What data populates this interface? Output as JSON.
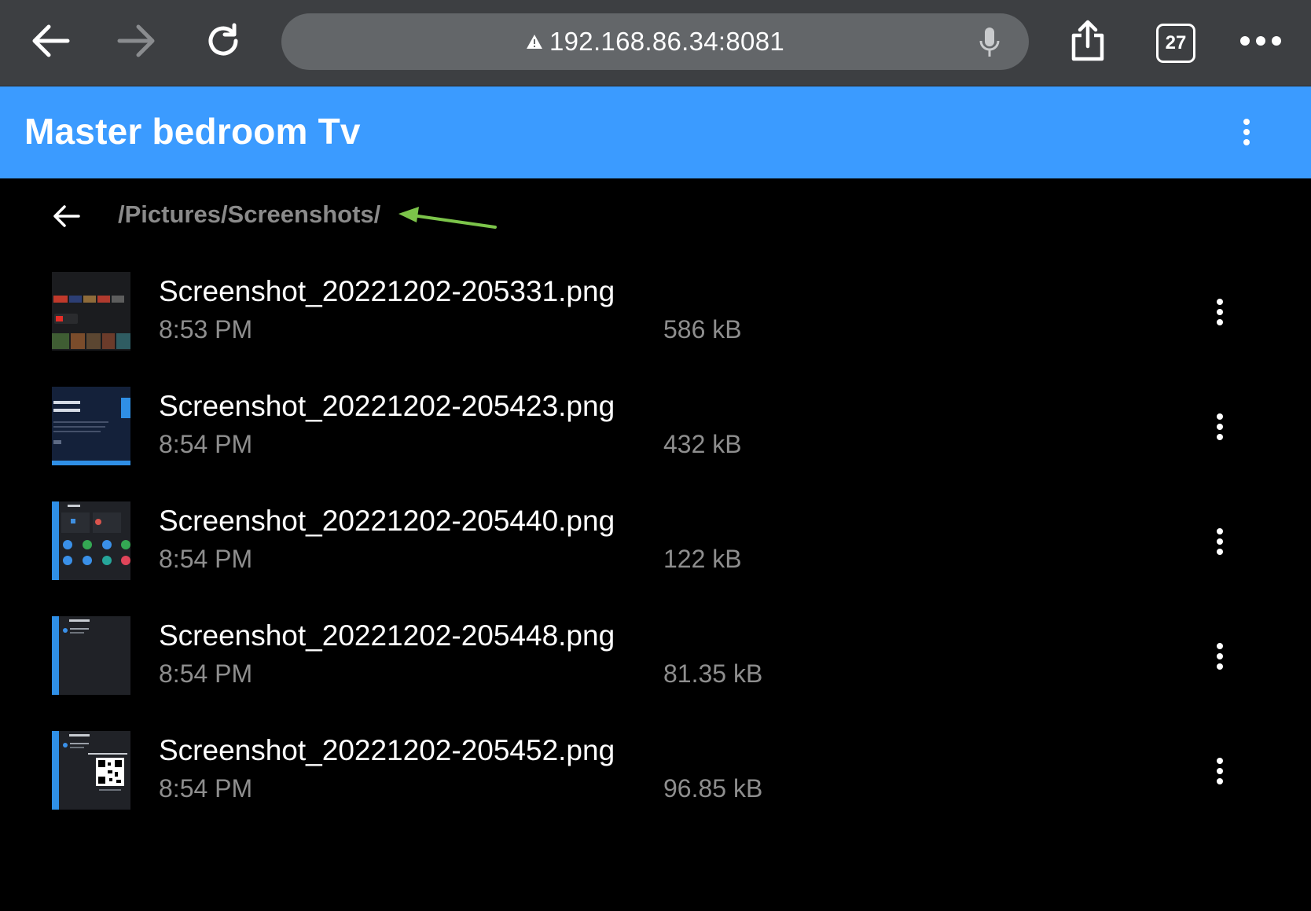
{
  "browser": {
    "url": "192.168.86.34:8081",
    "tab_count": "27",
    "icons": [
      "back-arrow-icon",
      "forward-arrow-icon",
      "reload-icon",
      "warning-icon",
      "microphone-icon",
      "share-icon",
      "tabs-icon",
      "more-icon"
    ]
  },
  "header": {
    "title": "Master bedroom Tv",
    "accent_color": "#3b9bff"
  },
  "path": {
    "current": "/Pictures/Screenshots/"
  },
  "files": [
    {
      "name": "Screenshot_20221202-205331.png",
      "time": "8:53 PM",
      "size": "586 kB"
    },
    {
      "name": "Screenshot_20221202-205423.png",
      "time": "8:54 PM",
      "size": "432 kB"
    },
    {
      "name": "Screenshot_20221202-205440.png",
      "time": "8:54 PM",
      "size": "122 kB"
    },
    {
      "name": "Screenshot_20221202-205448.png",
      "time": "8:54 PM",
      "size": "81.35 kB"
    },
    {
      "name": "Screenshot_20221202-205452.png",
      "time": "8:54 PM",
      "size": "96.85 kB"
    }
  ]
}
